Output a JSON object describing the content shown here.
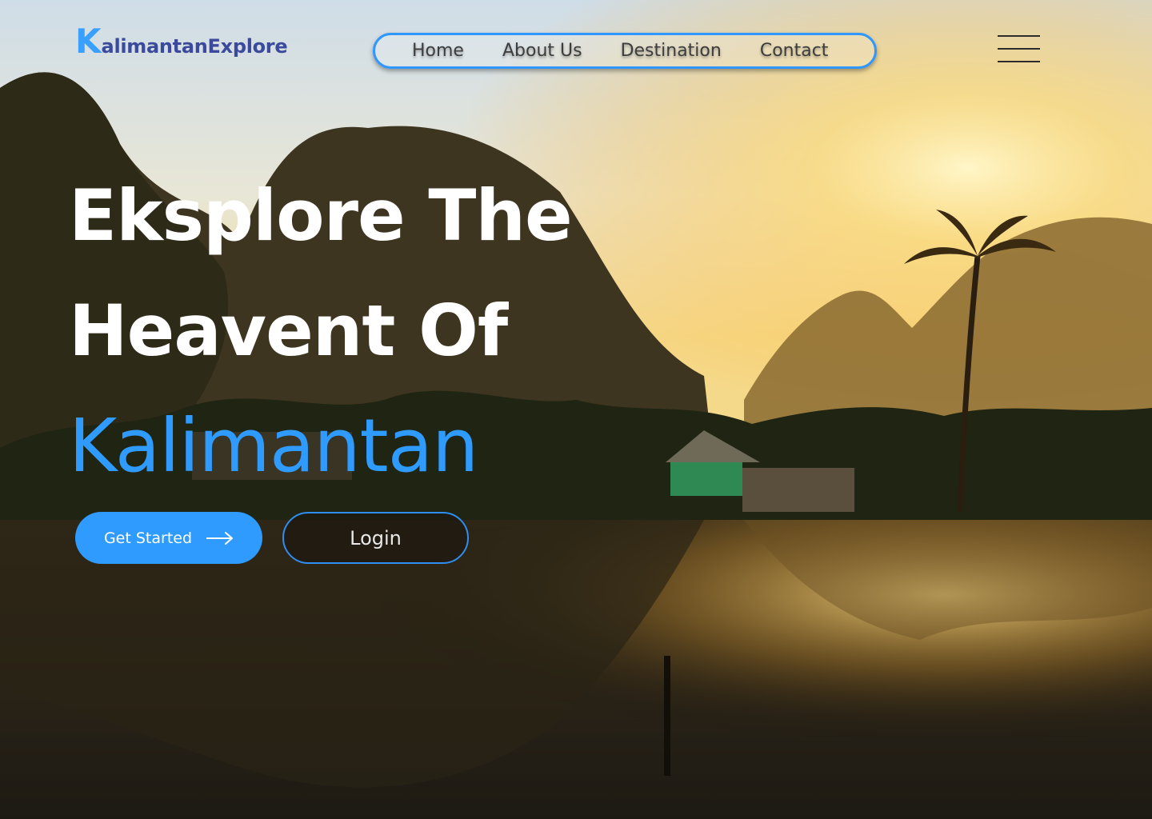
{
  "brand": {
    "logo_letter": "K",
    "logo_text": "alimantanExplore"
  },
  "nav": {
    "items": [
      {
        "label": "Home"
      },
      {
        "label": "About Us"
      },
      {
        "label": "Destination"
      },
      {
        "label": "Contact"
      }
    ]
  },
  "hero": {
    "line1": "Eksplore The",
    "line2": "Heavent Of",
    "line3": "Kalimantan",
    "primary_button": "Get Started",
    "secondary_button": "Login"
  },
  "colors": {
    "accent": "#2f9bff",
    "logo": "#3b4a9c"
  },
  "icons": {
    "menu": "hamburger-menu-icon",
    "arrow": "arrow-right-icon"
  }
}
